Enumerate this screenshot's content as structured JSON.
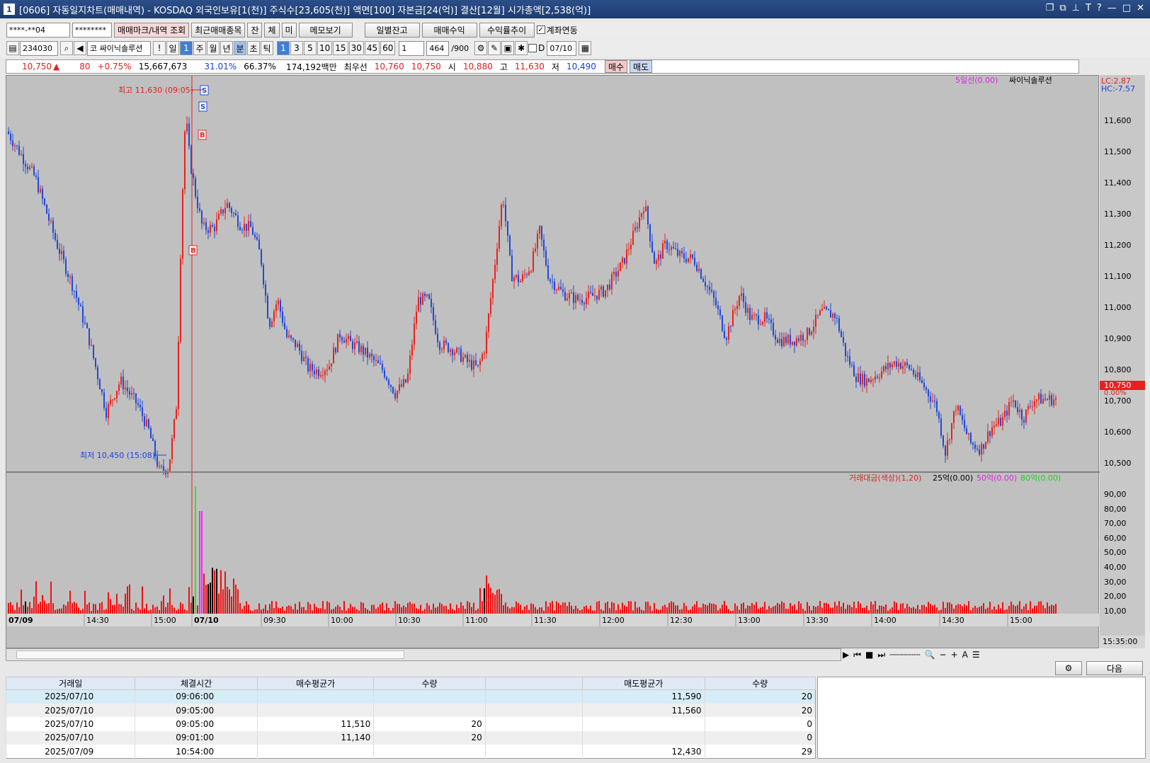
{
  "title": "[0606] 자동일지차트(매매내역) - KOSDAQ 외국인보유[1(천)] 주식수[23,605(천)] 액면[100] 자본금[24(억)] 결산[12월] 시가총액[2,538(억)]",
  "app_num": "1",
  "toolbar1": {
    "account": "****-**04",
    "password": "********",
    "btn_mark": "매매마크/내역 조회",
    "btn_recent": "최근매매종목",
    "btn_jan": "잔",
    "btn_che": "체",
    "btn_mi": "미",
    "btn_memo": "메모보기",
    "btn_daily": "일별잔고",
    "btn_profit": "매매수익",
    "btn_return": "수익률추이",
    "chk_account": "계좌연동"
  },
  "toolbar2": {
    "code": "234030",
    "name_prefix": "코",
    "stock_name": "싸이닉솔루션",
    "excl": "!",
    "period_day": "일",
    "period_num": "1",
    "periods": [
      "주",
      "월",
      "년",
      "분",
      "초",
      "틱"
    ],
    "mins": [
      "1",
      "3",
      "5",
      "10",
      "15",
      "30",
      "45",
      "60"
    ],
    "count": "1",
    "view": "464",
    "total": "/900",
    "date_prefix": "D",
    "date": "07/10"
  },
  "pricebar": {
    "price": "10,750",
    "arrow": "▲",
    "change": "80",
    "pct": "+0.75%",
    "volume": "15,667,673",
    "ratio1": "31.01%",
    "ratio2": "66.37%",
    "amount": "174,192백만",
    "best_label": "최우선",
    "best_sell": "10,760",
    "best_buy": "10,750",
    "open_label": "시",
    "open": "10,880",
    "high_label": "고",
    "high": "11,630",
    "low_label": "저",
    "low": "10,490",
    "buy_btn": "매수",
    "sell_btn": "매도"
  },
  "chart": {
    "ma_label": "5일선(0.00)",
    "name_label": "싸이닉솔루션",
    "lc": "LC:2.87",
    "hc": "HC:-7.57",
    "high_ann": "최고 11,630 (09:05)",
    "low_ann": "최저 10,450 (15:08)",
    "cur_price": "10,750",
    "cur_pct": "0.00%",
    "vol_legend": {
      "main": "거래대금(색상)(1,20)",
      "s1": "25억(0.00)",
      "s2": "50억(0.00)",
      "s3": "80억(0.00)"
    },
    "colors": {
      "up": "#e8221c",
      "down": "#2248d8",
      "bg": "#c0c0c0",
      "vol": "#ee1010",
      "mag": "#ff22ff",
      "grn": "#22ee22"
    }
  },
  "chart_data": {
    "type": "candlestick",
    "price_ticks": [
      "11,600",
      "11,500",
      "11,400",
      "11,300",
      "11,200",
      "11,100",
      "11,000",
      "10,900",
      "10,800",
      "10,700",
      "10,600",
      "10,500"
    ],
    "price_range": [
      10430,
      11680
    ],
    "vol_ticks": [
      "90,00",
      "80,00",
      "70,00",
      "60,00",
      "50,00",
      "40,00",
      "30,00",
      "20,00",
      "10,00"
    ],
    "time_labels": [
      "07/09",
      "14:30",
      "15:00",
      "07/10",
      "09:30",
      "10:00",
      "10:30",
      "11:00",
      "11:30",
      "12:00",
      "12:30",
      "13:00",
      "13:30",
      "14:00",
      "14:30",
      "15:00",
      "15:35:00"
    ],
    "markers": [
      {
        "t": "S"
      },
      {
        "t": "S"
      },
      {
        "t": "B"
      },
      {
        "t": "B"
      }
    ]
  },
  "tools": {
    "btn_next": "다음"
  },
  "grid": {
    "headers": [
      "거래일",
      "체결시간",
      "매수평균가",
      "수량",
      "",
      "매도평균가",
      "수량"
    ],
    "rows": [
      [
        "2025/07/10",
        "09:06:00",
        "",
        "",
        "",
        "11,590",
        "20"
      ],
      [
        "2025/07/10",
        "09:05:00",
        "",
        "",
        "",
        "11,560",
        "20"
      ],
      [
        "2025/07/10",
        "09:05:00",
        "11,510",
        "20",
        "",
        "",
        "0"
      ],
      [
        "2025/07/10",
        "09:01:00",
        "11,140",
        "20",
        "",
        "",
        "0"
      ],
      [
        "2025/07/09",
        "10:54:00",
        "",
        "",
        "",
        "12,430",
        "29"
      ]
    ]
  }
}
